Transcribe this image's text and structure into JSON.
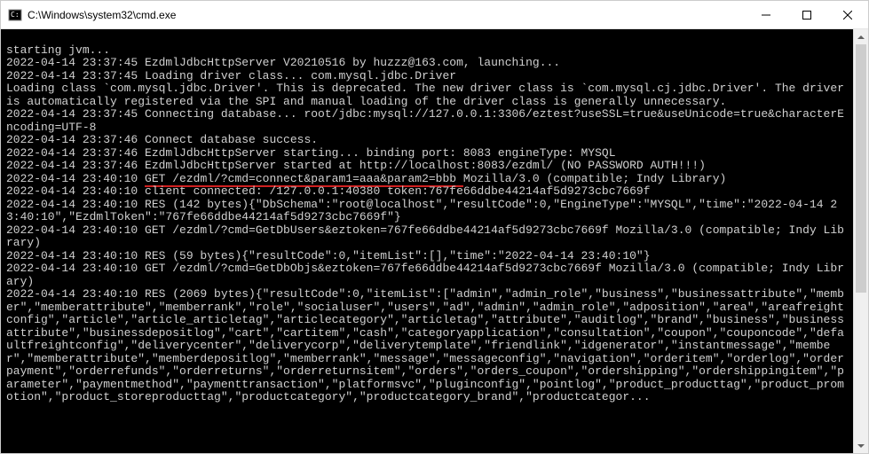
{
  "titlebar": {
    "title": "C:\\Windows\\system32\\cmd.exe"
  },
  "console": {
    "l01": "",
    "l02": "starting jvm...",
    "l03": "2022-04-14 23:37:45 EzdmlJdbcHttpServer V20210516 by huzzz@163.com, launching...",
    "l04": "2022-04-14 23:37:45 Loading driver class... com.mysql.jdbc.Driver",
    "l05": "Loading class `com.mysql.jdbc.Driver'. This is deprecated. The new driver class is `com.mysql.cj.jdbc.Driver'. The driver is automatically registered via the SPI and manual loading of the driver class is generally unnecessary.",
    "l06": "2022-04-14 23:37:45 Connecting database... root/jdbc:mysql://127.0.0.1:3306/eztest?useSSL=true&useUnicode=true&characterEncoding=UTF-8",
    "l07": "2022-04-14 23:37:46 Connect database success.",
    "l08": "2022-04-14 23:37:46 EzdmlJdbcHttpServer starting... binding port: 8083 engineType: MYSQL",
    "l09": "2022-04-14 23:37:46 EzdmlJdbcHttpServer started at http://localhost:8083/ezdml/ (NO PASSWORD AUTH!!!)",
    "l10_a": "2022-04-14 23:40:10 ",
    "l10_b": "GET /ezdml/?cmd=connect&param1=aaa&param2=bbb ",
    "l10_c": "Mozilla/3.0 (compatible; Indy Library)",
    "l11": "2022-04-14 23:40:10 client connected: /127.0.0.1:40380 token:767fe66ddbe44214af5d9273cbc7669f",
    "l12": "2022-04-14 23:40:10 RES (142 bytes){\"DbSchema\":\"root@localhost\",\"resultCode\":0,\"EngineType\":\"MYSQL\",\"time\":\"2022-04-14 23:40:10\",\"EzdmlToken\":\"767fe66ddbe44214af5d9273cbc7669f\"}",
    "l13": "2022-04-14 23:40:10 GET /ezdml/?cmd=GetDbUsers&eztoken=767fe66ddbe44214af5d9273cbc7669f Mozilla/3.0 (compatible; Indy Library)",
    "l14": "2022-04-14 23:40:10 RES (59 bytes){\"resultCode\":0,\"itemList\":[],\"time\":\"2022-04-14 23:40:10\"}",
    "l15": "2022-04-14 23:40:10 GET /ezdml/?cmd=GetDbObjs&eztoken=767fe66ddbe44214af5d9273cbc7669f Mozilla/3.0 (compatible; Indy Library)",
    "l16": "2022-04-14 23:40:10 RES (2069 bytes){\"resultCode\":0,\"itemList\":[\"admin\",\"admin_role\",\"business\",\"businessattribute\",\"member\",\"memberattribute\",\"memberrank\",\"role\",\"socialuser\",\"users\",\"ad\",\"admin\",\"admin_role\",\"adposition\",\"area\",\"areafreightconfig\",\"article\",\"article_articletag\",\"articlecategory\",\"articletag\",\"attribute\",\"auditlog\",\"brand\",\"business\",\"businessattribute\",\"businessdepositlog\",\"cart\",\"cartitem\",\"cash\",\"categoryapplication\",\"consultation\",\"coupon\",\"couponcode\",\"defaultfreightconfig\",\"deliverycenter\",\"deliverycorp\",\"deliverytemplate\",\"friendlink\",\"idgenerator\",\"instantmessage\",\"member\",\"memberattribute\",\"memberdepositlog\",\"memberrank\",\"message\",\"messageconfig\",\"navigation\",\"orderitem\",\"orderlog\",\"orderpayment\",\"orderrefunds\",\"orderreturns\",\"orderreturnsitem\",\"orders\",\"orders_coupon\",\"ordershipping\",\"ordershippingitem\",\"parameter\",\"paymentmethod\",\"paymenttransaction\",\"platformsvc\",\"pluginconfig\",\"pointlog\",\"product_producttag\",\"product_promotion\",\"product_storeproducttag\",\"productcategory\",\"productcategory_brand\",\"productcategor..."
  }
}
